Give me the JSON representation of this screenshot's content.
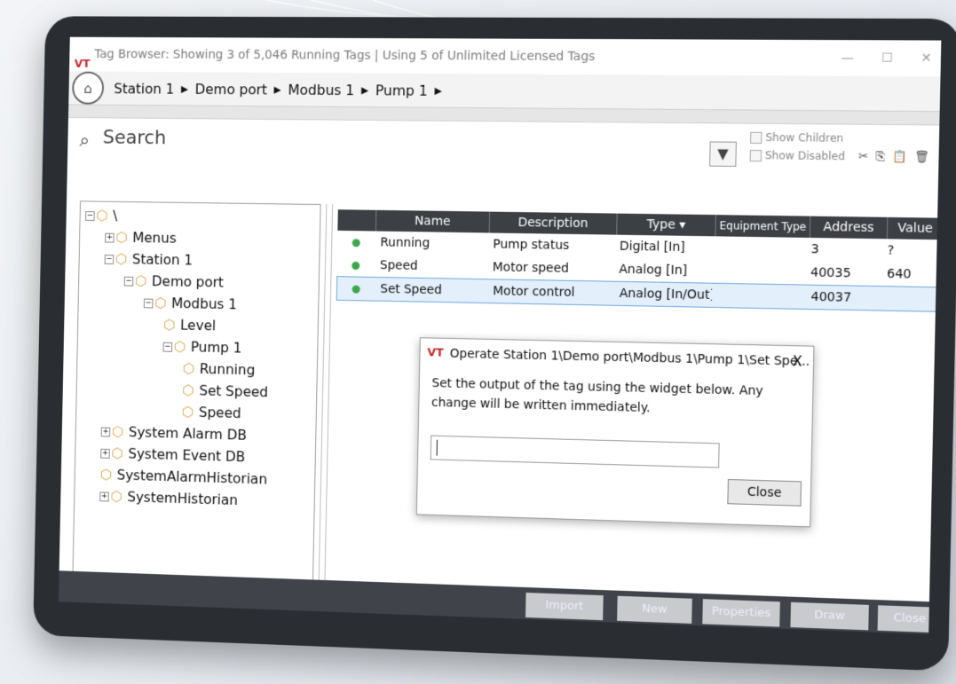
{
  "window": {
    "title": "Tag Browser: Showing 3 of 5,046 Running Tags | Using 5 of Unlimited Licensed Tags",
    "logo_text": "VT"
  },
  "breadcrumb": [
    "Station 1",
    "Demo port",
    "Modbus 1",
    "Pump 1"
  ],
  "search": {
    "label": "Search"
  },
  "options": {
    "show_children": "Show Children",
    "show_disabled": "Show Disabled"
  },
  "tree": [
    {
      "label": "\\",
      "exp": "−",
      "indent": 0
    },
    {
      "label": "Menus",
      "exp": "+",
      "indent": 1
    },
    {
      "label": "Station 1",
      "exp": "−",
      "indent": 1
    },
    {
      "label": "Demo port",
      "exp": "−",
      "indent": 2
    },
    {
      "label": "Modbus 1",
      "exp": "−",
      "indent": 3
    },
    {
      "label": "Level",
      "exp": "",
      "indent": 4
    },
    {
      "label": "Pump 1",
      "exp": "−",
      "indent": 4
    },
    {
      "label": "Running",
      "exp": "",
      "indent": 5
    },
    {
      "label": "Set Speed",
      "exp": "",
      "indent": 5
    },
    {
      "label": "Speed",
      "exp": "",
      "indent": 5
    },
    {
      "label": "System Alarm DB",
      "exp": "+",
      "indent": 1
    },
    {
      "label": "System Event DB",
      "exp": "+",
      "indent": 1
    },
    {
      "label": "SystemAlarmHistorian",
      "exp": "",
      "indent": 1
    },
    {
      "label": "SystemHistorian",
      "exp": "+",
      "indent": 1
    }
  ],
  "table": {
    "columns": [
      "Name",
      "Description",
      "Type",
      "Equipment Type",
      "Address",
      "Value"
    ],
    "rows": [
      {
        "name": "Running",
        "description": "Pump status",
        "type": "Digital [In]",
        "equipment_type": "",
        "address": "3",
        "value": "?"
      },
      {
        "name": "Speed",
        "description": "Motor speed",
        "type": "Analog [In]",
        "equipment_type": "",
        "address": "40035",
        "value": "640"
      },
      {
        "name": "Set Speed",
        "description": "Motor control",
        "type": "Analog [In/Out]",
        "equipment_type": "",
        "address": "40037",
        "value": "",
        "selected": true
      }
    ]
  },
  "dialog": {
    "title": "Operate Station 1\\Demo port\\Modbus 1\\Pump 1\\Set Spe...",
    "message": "Set the output of the tag using the widget below. Any change will be written immediately.",
    "input_value": "",
    "close_label": "Close",
    "close_x": "X"
  },
  "bottom_buttons": [
    "Import",
    "New",
    "Properties",
    "Draw",
    "Close"
  ]
}
